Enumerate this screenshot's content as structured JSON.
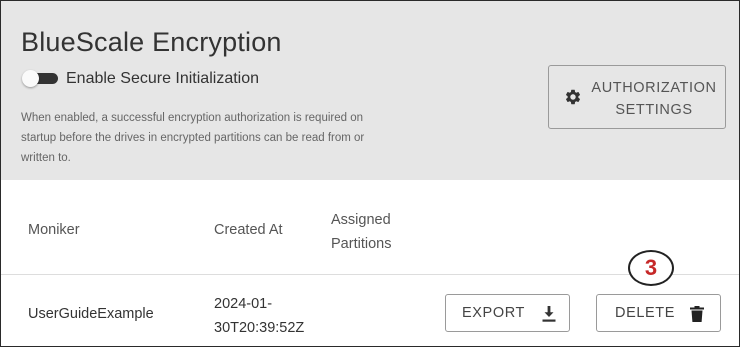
{
  "header": {
    "title": "BlueScale Encryption"
  },
  "secure_init": {
    "label": "Enable Secure Initialization",
    "enabled": false,
    "help_text": "When enabled, a successful encryption authorization is required on startup before the drives in encrypted partitions can be read from or written to."
  },
  "auth_settings_button": {
    "label": "AUTHORIZATION\nSETTINGS",
    "icon": "gear-icon"
  },
  "table": {
    "columns": [
      "Moniker",
      "Created At",
      "Assigned\nPartitions"
    ],
    "rows": [
      {
        "moniker": "UserGuideExample",
        "created_at": "2024-01-\n30T20:39:52Z",
        "assigned_partitions": "",
        "export_label": "EXPORT",
        "delete_label": "DELETE"
      }
    ]
  },
  "annotation": {
    "callout_number": "3",
    "callout_color": "#c62828"
  },
  "colors": {
    "panel_background": "#e6e6e6",
    "text": "#333333",
    "muted_text": "#666666"
  }
}
